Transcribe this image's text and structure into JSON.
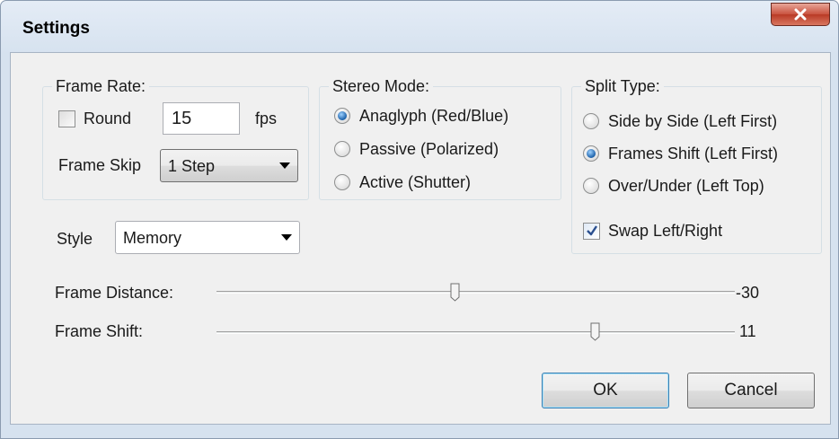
{
  "window": {
    "title": "Settings"
  },
  "frame_rate": {
    "group_title": "Frame Rate:",
    "round_label": "Round",
    "round_checked": false,
    "fps_value": "15",
    "fps_unit": "fps",
    "frame_skip_label": "Frame Skip",
    "frame_skip_value": "1 Step"
  },
  "style": {
    "label": "Style",
    "value": "Memory"
  },
  "stereo_mode": {
    "group_title": "Stereo Mode:",
    "options": [
      {
        "label": "Anaglyph (Red/Blue)",
        "selected": true
      },
      {
        "label": "Passive (Polarized)",
        "selected": false
      },
      {
        "label": "Active (Shutter)",
        "selected": false
      }
    ]
  },
  "split_type": {
    "group_title": "Split Type:",
    "options": [
      {
        "label": "Side by Side (Left First)",
        "selected": false
      },
      {
        "label": "Frames Shift (Left First)",
        "selected": true
      },
      {
        "label": "Over/Under (Left Top)",
        "selected": false
      }
    ],
    "swap_label": "Swap Left/Right",
    "swap_checked": true
  },
  "sliders": {
    "frame_distance": {
      "label": "Frame Distance:",
      "value": "-30",
      "fraction": 0.46
    },
    "frame_shift": {
      "label": "Frame Shift:",
      "value": "11",
      "fraction": 0.73
    }
  },
  "buttons": {
    "ok": "OK",
    "cancel": "Cancel"
  },
  "colors": {
    "accent": "#3c7fb1",
    "close_button": "#c9523e",
    "dialog_bg": "#f0f0f0"
  }
}
